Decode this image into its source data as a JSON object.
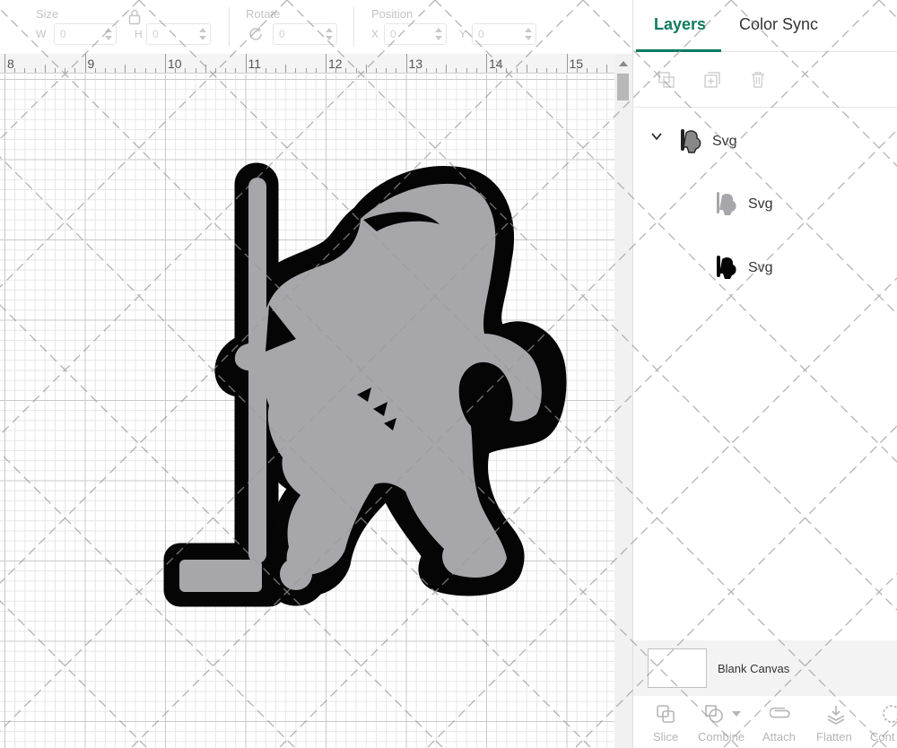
{
  "toolbar": {
    "size_label": "Size",
    "width_label": "W",
    "width_value": "0",
    "height_label": "H",
    "height_value": "0",
    "rotate_label": "Rotate",
    "rotate_value": "0",
    "position_label": "Position",
    "x_label": "X",
    "x_value": "0",
    "y_label": "Y",
    "y_value": "0"
  },
  "ruler": {
    "numbers": [
      "8",
      "9",
      "10",
      "11",
      "12",
      "13",
      "14",
      "15"
    ]
  },
  "panel": {
    "tabs": [
      {
        "label": "Layers",
        "active": true
      },
      {
        "label": "Color Sync",
        "active": false
      }
    ],
    "layers": [
      {
        "label": "Svg",
        "level": 0,
        "expanded": true
      },
      {
        "label": "Svg",
        "level": 1
      },
      {
        "label": "Svg",
        "level": 1
      }
    ],
    "blank_canvas_label": "Blank Canvas",
    "bottom_tools": [
      {
        "label": "Slice",
        "icon": "slice-icon"
      },
      {
        "label": "Combine",
        "icon": "combine-icon"
      },
      {
        "label": "Attach",
        "icon": "attach-icon"
      },
      {
        "label": "Flatten",
        "icon": "flatten-icon"
      },
      {
        "label": "Cont",
        "icon": "contour-icon"
      }
    ]
  },
  "colors": {
    "accent": "#0e7a5f",
    "design_fill": "#a7a6ab",
    "design_outline": "#050505"
  }
}
